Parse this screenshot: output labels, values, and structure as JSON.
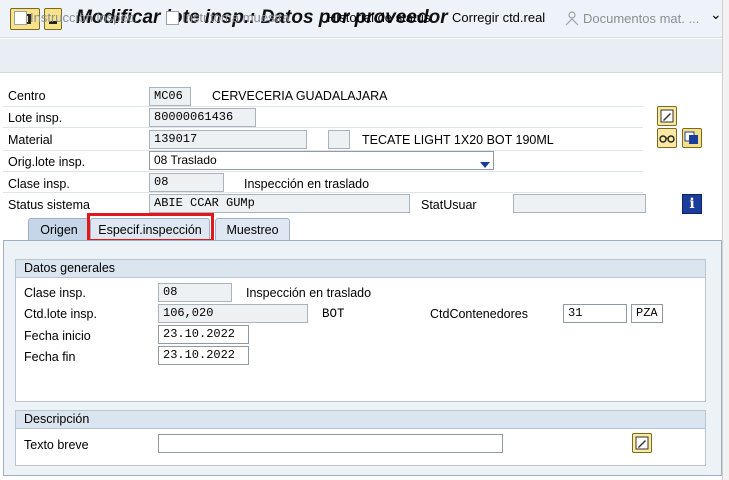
{
  "window": {
    "title": "Modificar lote insp.: Datos por proveedor"
  },
  "toolbar": {
    "instruccion": "Instrucción inspec.",
    "instr_toma": "Instr.toma muestra",
    "historial": "Historial de status",
    "corregir": "Corregir ctd.real",
    "documentos": "Documentos mat. ...",
    "more": "⌄"
  },
  "header": {
    "centro_label": "Centro",
    "centro_value": "MC06",
    "centro_desc": "CERVECERIA GUADALAJARA",
    "lote_label": "Lote insp.",
    "lote_value": "80000061436",
    "material_label": "Material",
    "material_value": "139017",
    "material_desc": "TECATE LIGHT  1X20 BOT 190ML",
    "orig_label": "Orig.lote insp.",
    "orig_value": "08 Traslado",
    "clase_label": "Clase insp.",
    "clase_value": "08",
    "clase_desc": "Inspección en traslado",
    "status_label": "Status sistema",
    "status_value": "ABIE CCAR GUMp",
    "statusuar_label": "StatUsuar",
    "statusuar_value": ""
  },
  "tabs": [
    {
      "label": "Origen"
    },
    {
      "label": "Especif.inspección"
    },
    {
      "label": "Muestreo"
    }
  ],
  "datos_generales": {
    "title": "Datos generales",
    "clase_label": "Clase insp.",
    "clase_value": "08",
    "clase_desc": "Inspección en traslado",
    "ctd_label": "Ctd.lote insp.",
    "ctd_value": "106,020",
    "ctd_unit": "BOT",
    "contenedores_label": "CtdContenedores",
    "contenedores_value": "31",
    "contenedores_unit": "PZA",
    "fecha_inicio_label": "Fecha inicio",
    "fecha_inicio_value": "23.10.2022",
    "fecha_fin_label": "Fecha fin",
    "fecha_fin_value": "23.10.2022"
  },
  "descripcion": {
    "title": "Descripción",
    "texto_label": "Texto breve",
    "texto_value": ""
  },
  "colors": {
    "highlight": "#e0181c",
    "info_icon": "#1a3c9a"
  },
  "icons": [
    "menu-icon",
    "document-icon",
    "person-doc-icon",
    "edit-icon",
    "glasses-icon",
    "copy-icon",
    "info-icon",
    "dropdown-arrow-icon"
  ]
}
